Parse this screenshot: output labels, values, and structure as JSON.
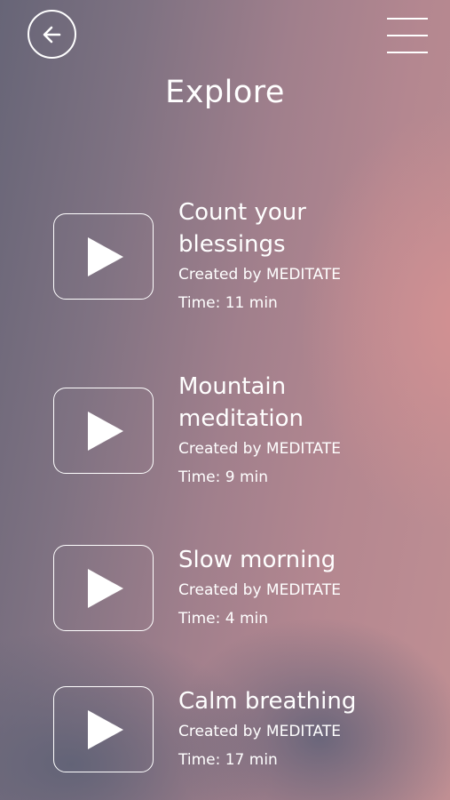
{
  "header": {
    "title": "Explore",
    "back_icon": "arrow-left-icon",
    "menu_icon": "hamburger-menu-icon"
  },
  "tracks": [
    {
      "title": "Count your blessings",
      "creator": "Created by MEDITATE",
      "time": "Time: 11 min"
    },
    {
      "title": "Mountain meditation",
      "creator": "Created by MEDITATE",
      "time": "Time: 9 min"
    },
    {
      "title": "Slow morning",
      "creator": "Created by MEDITATE",
      "time": "Time: 4 min"
    },
    {
      "title": "Calm breathing",
      "creator": "Created by MEDITATE",
      "time": "Time: 17 min"
    }
  ],
  "colors": {
    "foreground": "#ffffff",
    "background_left": "#676577",
    "background_right": "#c08f93"
  }
}
